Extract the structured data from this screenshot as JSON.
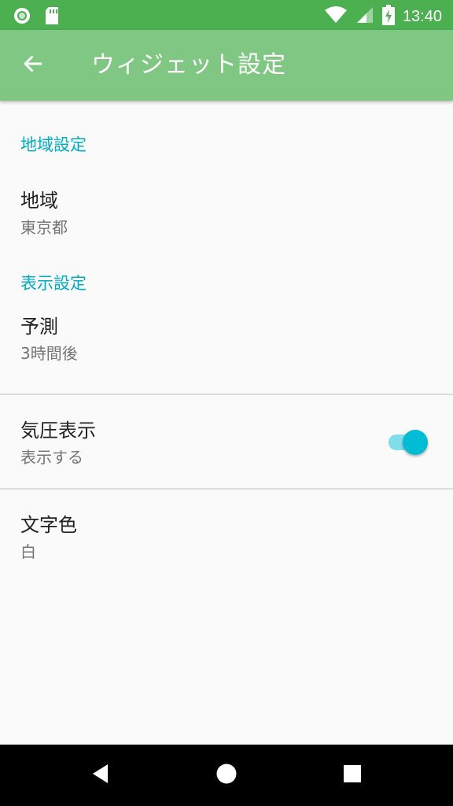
{
  "status_bar": {
    "time": "13:40",
    "icons_left": [
      "circle-notification-icon",
      "sd-card-icon"
    ],
    "icons_right": [
      "wifi-icon",
      "signal-icon",
      "battery-charging-icon"
    ]
  },
  "app_bar": {
    "title": "ウィジェット設定",
    "back_icon": "arrow-back-icon",
    "color": "#81c784"
  },
  "sections": [
    {
      "category": "地域設定",
      "items": [
        {
          "title": "地域",
          "summary": "東京都"
        }
      ]
    },
    {
      "category": "表示設定",
      "items": [
        {
          "title": "予測",
          "summary": "3時間後"
        },
        {
          "title": "気圧表示",
          "summary": "表示する",
          "toggle": true
        },
        {
          "title": "文字色",
          "summary": "白"
        }
      ]
    }
  ],
  "colors": {
    "status_bar": "#4caf50",
    "accent": "#00acc1",
    "switch_thumb": "#00bcd4"
  },
  "nav_bar": {
    "buttons": [
      "back-triangle-icon",
      "home-circle-icon",
      "recents-square-icon"
    ]
  }
}
